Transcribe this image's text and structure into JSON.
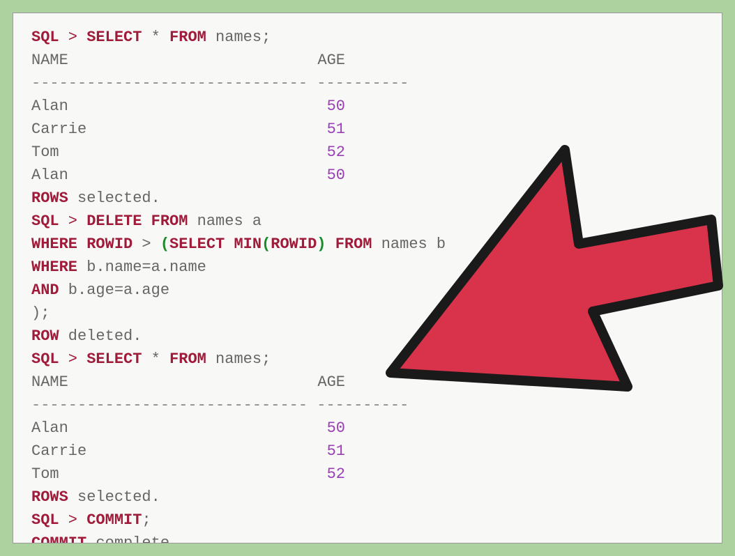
{
  "prompt": "SQL",
  "prompt_sep": " > ",
  "kw": {
    "SELECT": "SELECT",
    "FROM": "FROM",
    "DELETE": "DELETE",
    "WHERE": "WHERE",
    "ROWID": "ROWID",
    "MIN": "MIN",
    "AND": "AND",
    "COMMIT": "COMMIT",
    "ROWS": "ROWS",
    "ROW": "ROW"
  },
  "text": {
    "star": "*",
    "names_semi": " names;",
    "names_a": " names a",
    "names_b": " names b",
    "bname_aname": " b.name=a.name",
    "bage_aage": " b.age=a.age",
    "close_stmt": ");",
    "selected": " selected.",
    "deleted": " deleted.",
    "commit_semi": ";",
    "complete": " complete.",
    "gt_paren": " > ",
    "space": " "
  },
  "headers": {
    "name": "NAME",
    "age": "AGE"
  },
  "divider1": "------------------------------ ----------",
  "divider2": "------------------------------ ----------",
  "table1": [
    {
      "name": "Alan",
      "age": "50"
    },
    {
      "name": "Carrie",
      "age": "51"
    },
    {
      "name": "Tom",
      "age": "52"
    },
    {
      "name": "Alan",
      "age": "50"
    }
  ],
  "table2": [
    {
      "name": "Alan",
      "age": "50"
    },
    {
      "name": "Carrie",
      "age": "51"
    },
    {
      "name": "Tom",
      "age": "52"
    }
  ],
  "paren_open": "(",
  "paren_close": ")"
}
